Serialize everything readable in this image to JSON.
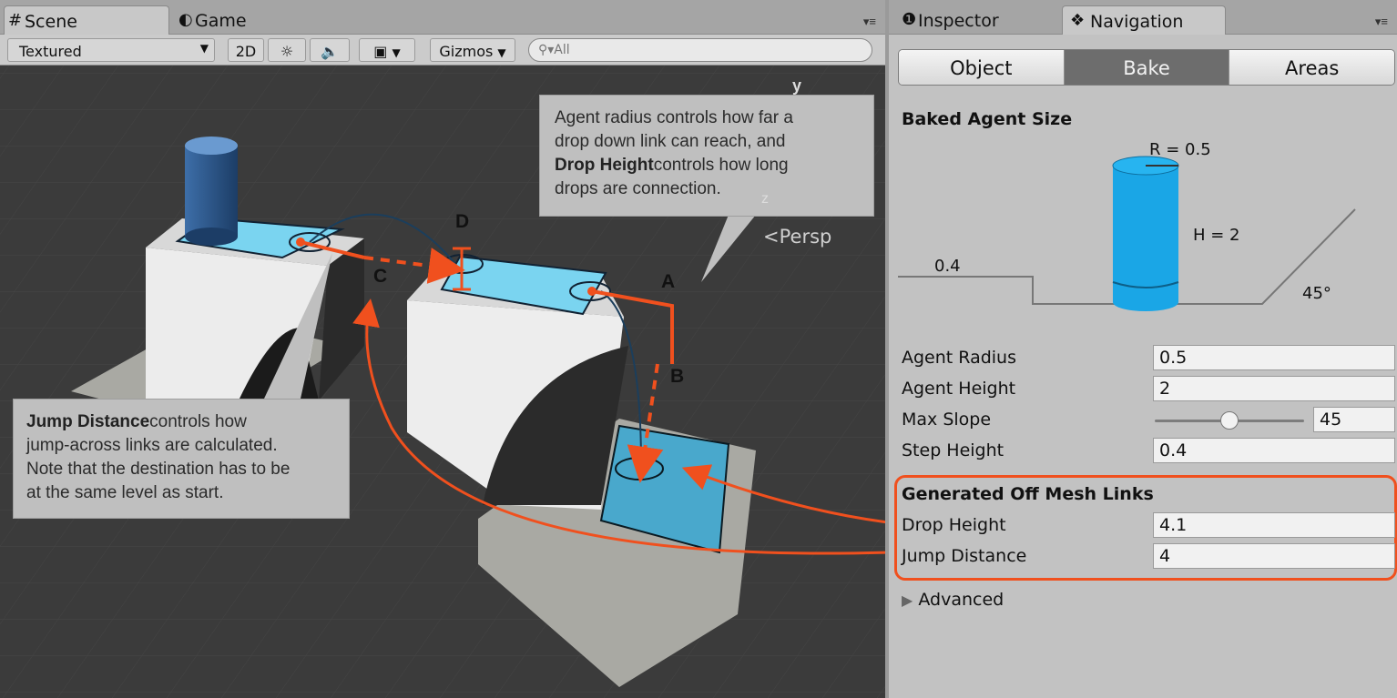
{
  "scene": {
    "tabs": [
      {
        "label": "Scene",
        "icon": "grid-icon"
      },
      {
        "label": "Game",
        "icon": "pacman-icon"
      }
    ],
    "toolbar": {
      "draw_mode": "Textured",
      "btn_2d": "2D",
      "gizmos": "Gizmos",
      "search_placeholder": "All"
    },
    "persp_label": "Persp",
    "axis_label_y": "y",
    "axis_label_z": "z",
    "letters": {
      "a": "A",
      "b": "B",
      "c": "C",
      "d": "D"
    },
    "callouts": {
      "agent_radius": {
        "line1": "Agent radius controls how far a",
        "line2": "drop down link can reach, and",
        "bold": "Drop Height",
        "line3_rest": "controls how long",
        "line4": "drops are connection."
      },
      "jump_distance": {
        "bold": "Jump Distance",
        "line1_rest": "controls how",
        "line2": "jump-across links are calculated.",
        "line3": "Note that the destination has to be",
        "line4": "at the same level as start."
      }
    }
  },
  "inspector": {
    "tabs": [
      {
        "label": "Inspector",
        "icon": "info-icon"
      },
      {
        "label": "Navigation",
        "icon": "navigation-icon"
      }
    ],
    "segments": [
      "Object",
      "Bake",
      "Areas"
    ],
    "active_segment": "Bake",
    "baked_agent_size_title": "Baked Agent Size",
    "diagram": {
      "radius": "R = 0.5",
      "height": "H = 2",
      "step": "0.4",
      "slope": "45°"
    },
    "fields": [
      {
        "label": "Agent Radius",
        "value": "0.5"
      },
      {
        "label": "Agent Height",
        "value": "2"
      },
      {
        "label": "Max Slope",
        "value": "45",
        "slider_fraction": 0.5
      },
      {
        "label": "Step Height",
        "value": "0.4"
      }
    ],
    "generated_title": "Generated Off Mesh Links",
    "generated_fields": [
      {
        "label": "Drop Height",
        "value": "4.1"
      },
      {
        "label": "Jump Distance",
        "value": "4"
      }
    ],
    "advanced_label": "Advanced"
  },
  "colors": {
    "accent_orange": "#f0501e",
    "navmesh_blue": "#6fd3f5",
    "agent_blue": "#1aa6e6"
  }
}
